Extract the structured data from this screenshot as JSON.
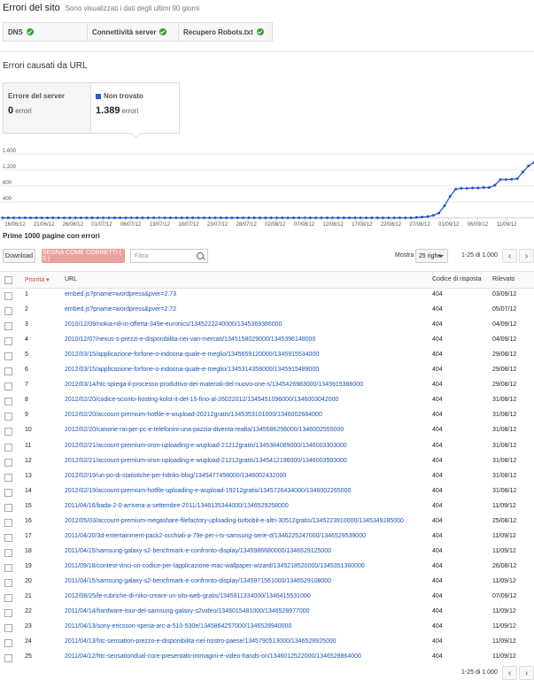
{
  "header": {
    "title": "Errori del sito",
    "subtitle": "Sono visualizzati i dati degli ultimi 90 giorni"
  },
  "status": [
    {
      "label": "DNS"
    },
    {
      "label": "Connettività server"
    },
    {
      "label": "Recupero Robots.txt"
    }
  ],
  "section_title": "Errori causati da URL",
  "cards": [
    {
      "label": "Errore del server",
      "value": "0",
      "unit": "errori"
    },
    {
      "label": "Non trovato",
      "value": "1.389",
      "unit": "errori"
    }
  ],
  "chart_data": {
    "type": "line",
    "color": "#1f4fd6",
    "x": [
      "16/06/12",
      "21/06/12",
      "26/06/12",
      "01/07/12",
      "06/07/12",
      "13/07/12",
      "18/07/12",
      "23/07/12",
      "28/07/12",
      "02/08/12",
      "07/08/12",
      "12/08/12",
      "17/08/12",
      "22/08/12",
      "27/08/12",
      "01/09/12",
      "06/09/12",
      "11/09/12"
    ],
    "yticks": [
      "1.600",
      "1.200",
      "800",
      "400"
    ],
    "ylim": [
      0,
      1600
    ],
    "values": [
      0,
      0,
      0,
      0,
      0,
      0,
      0,
      0,
      0,
      0,
      0,
      0,
      0,
      0,
      0,
      0,
      0,
      0,
      0,
      0,
      0,
      0,
      0,
      0,
      0,
      0,
      0,
      0,
      0,
      0,
      0,
      0,
      0,
      0,
      0,
      0,
      0,
      0,
      0,
      0,
      0,
      0,
      0,
      0,
      0,
      0,
      0,
      0,
      0,
      0,
      0,
      0,
      0,
      0,
      0,
      0,
      0,
      0,
      0,
      0,
      0,
      0,
      0,
      0,
      0,
      0,
      0,
      0,
      0,
      0,
      0,
      0,
      0,
      0,
      10,
      20,
      30,
      60,
      120,
      300,
      540,
      720,
      740,
      740,
      750,
      750,
      760,
      760,
      820,
      960,
      960,
      970,
      980,
      1150,
      1300,
      1390
    ]
  },
  "list_title": "Prime 1000 pagine con errori",
  "toolbar": {
    "download": "Download",
    "mark": "SEGNA COME CORRETTI ( 0 )",
    "filter_placeholder": "Filtra",
    "show": "Mostra",
    "rows_select": "25 righe",
    "range": "1-25 di 1.000"
  },
  "table": {
    "headers": {
      "priority": "Priorità",
      "url": "URL",
      "code": "Codice di risposta",
      "detected": "Rilevato"
    },
    "rows": [
      {
        "n": "1",
        "url": "embed.js?pname=wordpress&pver=2.73",
        "code": "404",
        "date": "03/09/12"
      },
      {
        "n": "2",
        "url": "embed.js?pname=wordpress&pver=2.72",
        "code": "404",
        "date": "05/07/12"
      },
      {
        "n": "3",
        "url": "2010/12/09/nokia-n8-in-offerta-349e-euronics/1345222240000/1345369386000",
        "code": "404",
        "date": "04/09/12"
      },
      {
        "n": "4",
        "url": "2010/12/07/nexus-s-prezzi-e-disponibilita-nei-vari-mercati/1345158029000/1345396148000",
        "code": "404",
        "date": "04/09/12"
      },
      {
        "n": "5",
        "url": "2012/03/15/applicazione-forfone-o-indoona-quale-e-meglio/1345659120000/1345915534000",
        "code": "404",
        "date": "29/08/12"
      },
      {
        "n": "6",
        "url": "2012/03/15/applicazione-forfone-o-indoona-quale-e-meglio/1345314358000/1345915489000",
        "code": "404",
        "date": "29/08/12"
      },
      {
        "n": "7",
        "url": "2012/03/14/htc-spiega-il-processo-produttivo-dei-materiali-del-nuovo-one-s/1345426983000/1345915388000",
        "code": "404",
        "date": "29/08/12"
      },
      {
        "n": "8",
        "url": "2012/02/20/codice-sconto-hosting-kolst-it-del-15-fino-al-26022012/1345451096000/1346003042000",
        "code": "404",
        "date": "31/08/12"
      },
      {
        "n": "9",
        "url": "2012/02/20/account-premium-hotfile-e-wupload-20212gratis/1345353101000/1346002684000",
        "code": "404",
        "date": "31/08/12"
      },
      {
        "n": "10",
        "url": "2012/02/20/canone-rai-per-pc-e-telefonini-una-pazzia-diventa-realta/1345586256000/1346002555000",
        "code": "404",
        "date": "31/08/12"
      },
      {
        "n": "11",
        "url": "2012/02/21/account-premium-oron-uploading-e-wupload-21212gratis/1345384089000/1346003303000",
        "code": "404",
        "date": "31/08/12"
      },
      {
        "n": "12",
        "url": "2012/02/21/account-premium-oron-uploading-e-wupload-21212gratis/1345412196000/1346003593000",
        "code": "404",
        "date": "31/08/12"
      },
      {
        "n": "13",
        "url": "2012/02/19/un-po-di-statistiche-per-hdriks-blog/1345477458000/1346002432000",
        "code": "404",
        "date": "31/08/12"
      },
      {
        "n": "14",
        "url": "2012/02/19/account-premium-hotfile-uploading-e-wupload-19212gratis/1345726434000/1346002265000",
        "code": "404",
        "date": "31/08/12"
      },
      {
        "n": "15",
        "url": "2011/04/16/bada-2-0-arrivera-a-settembre-2011/1346135344000/1346529258000",
        "code": "404",
        "date": "11/09/12"
      },
      {
        "n": "16",
        "url": "2012/05/03/account-premium-megashare-filefactory-uploading-turbobit-e-altri-30512gratis/1345223910000/1345349285000",
        "code": "404",
        "date": "25/08/12"
      },
      {
        "n": "17",
        "url": "2011/04/20/3d-entertainment-pack2-occhiali-a-79e-per-i-tv-samsung-serie-d/1346225247000/1346529539000",
        "code": "404",
        "date": "11/09/12"
      },
      {
        "n": "18",
        "url": "2011/04/15/samsung-galaxy-s2-benchmark-e-confronto-display/1345986680000/1346529125000",
        "code": "404",
        "date": "11/09/12"
      },
      {
        "n": "19",
        "url": "2011/09/18/contest-vinci-un-codice-per-lapplicazione-mac-wallpaper-wizard/1345218520000/1345351360000",
        "code": "404",
        "date": "26/08/12"
      },
      {
        "n": "20",
        "url": "2011/04/15/samsung-galaxy-s2-benchmark-e-confronto-display/1345971561000/1346529108000",
        "code": "404",
        "date": "11/09/12"
      },
      {
        "n": "21",
        "url": "2012/08/25/le-rubriche-di-niko-creare-un-sito-web-gratis/1345911334000/1346415531000",
        "code": "404",
        "date": "07/09/12"
      },
      {
        "n": "22",
        "url": "2011/04/14/hardware-tour-del-samsung-galaxy-s2video/1346015481000/1346528977000",
        "code": "404",
        "date": "11/09/12"
      },
      {
        "n": "23",
        "url": "2011/04/13/sony-ericsson-xperia-arc-a-510-530e/1345864257000/1346528940000",
        "code": "404",
        "date": "11/09/12"
      },
      {
        "n": "24",
        "url": "2011/04/13/htc-sensation-prezzo-e-disponibilita-nel-nostro-paese/1345790513000/1346528925000",
        "code": "404",
        "date": "11/09/12"
      },
      {
        "n": "25",
        "url": "2011/04/12/htc-sensationdual-core-presentato-immagini-e-video-hands-on/1346012522000/1346528864000",
        "code": "404",
        "date": "11/09/12"
      }
    ]
  }
}
